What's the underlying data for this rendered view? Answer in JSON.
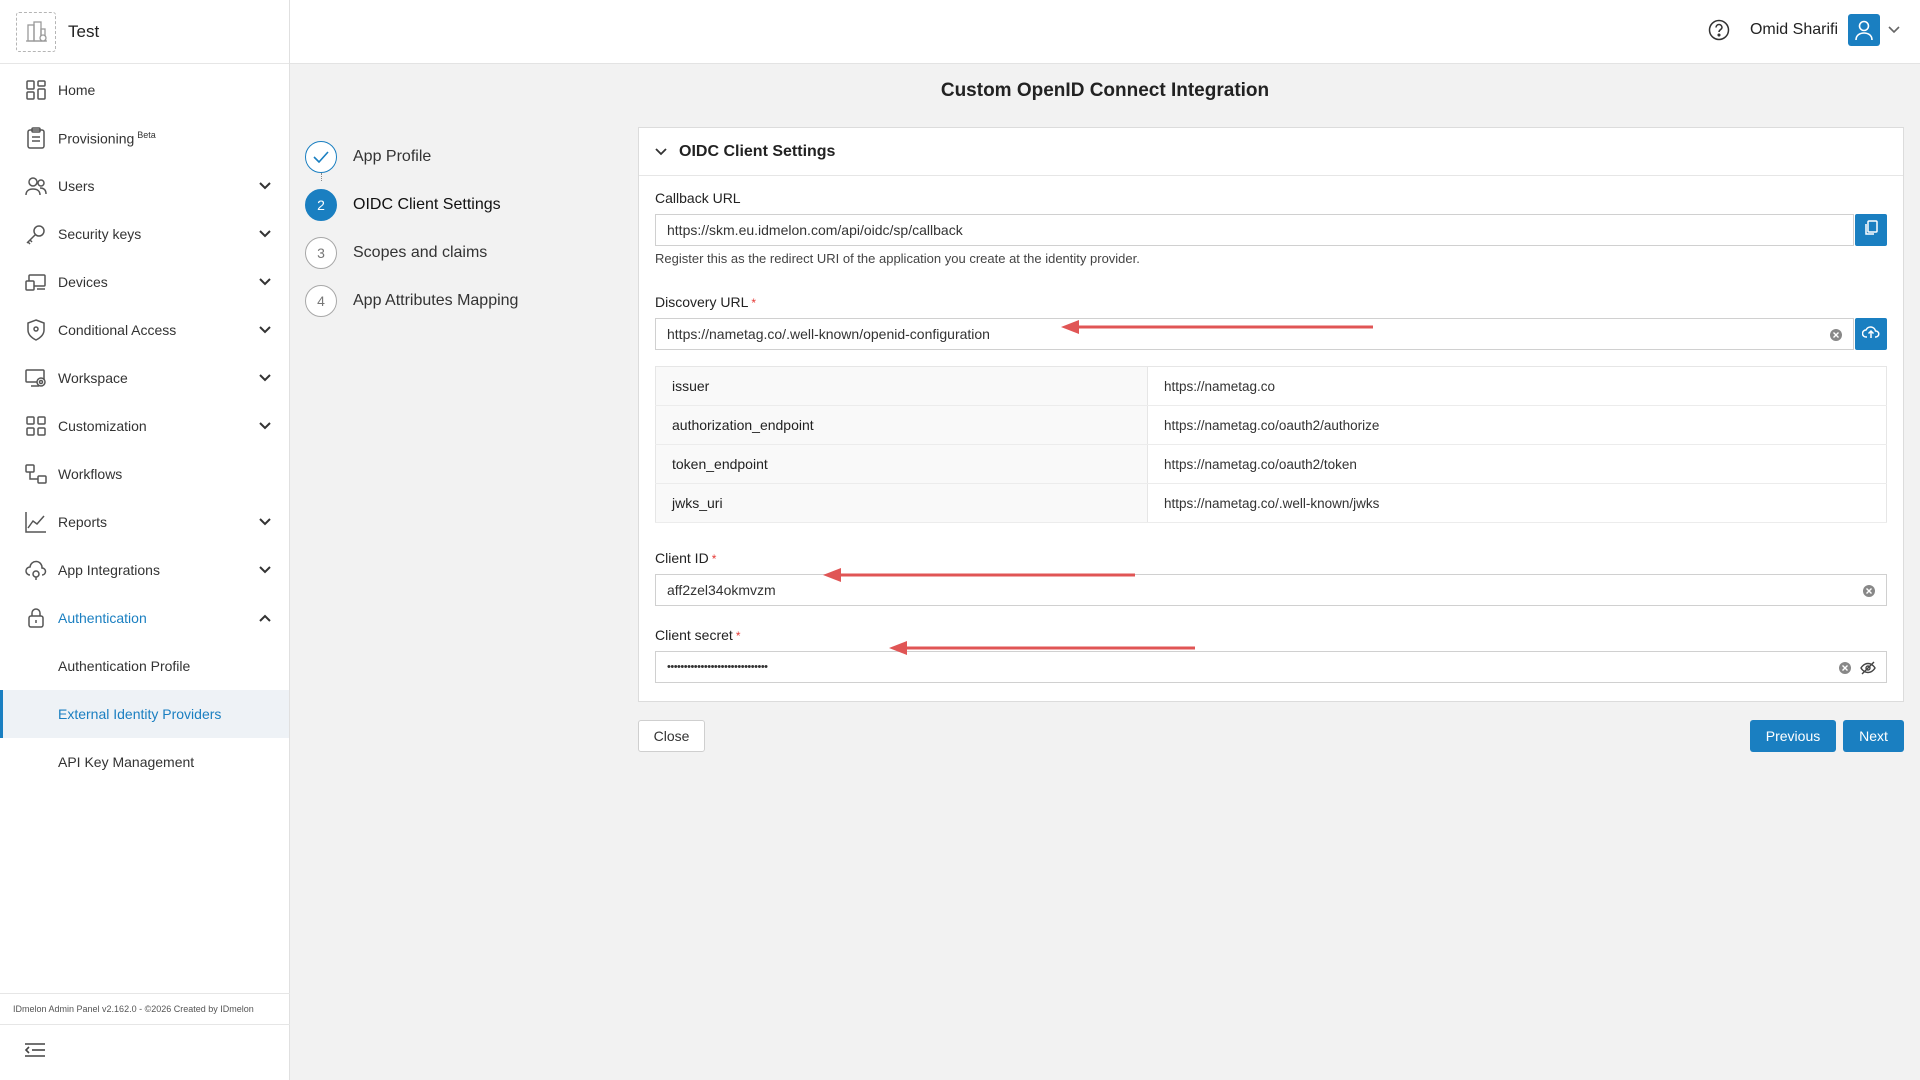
{
  "sidebar": {
    "brand": "Test",
    "items": [
      {
        "label": "Home",
        "icon": "home-icon"
      },
      {
        "label": "Provisioning",
        "badge": "Beta",
        "icon": "clipboard-icon"
      },
      {
        "label": "Users",
        "icon": "users-icon"
      },
      {
        "label": "Security keys",
        "icon": "key-icon"
      },
      {
        "label": "Devices",
        "icon": "devices-icon"
      },
      {
        "label": "Conditional Access",
        "icon": "shield-icon"
      },
      {
        "label": "Workspace",
        "icon": "workspace-icon"
      },
      {
        "label": "Customization",
        "icon": "grid-icon"
      },
      {
        "label": "Workflows",
        "icon": "workflow-icon"
      },
      {
        "label": "Reports",
        "icon": "chart-icon"
      },
      {
        "label": "App Integrations",
        "icon": "cloud-icon"
      },
      {
        "label": "Authentication",
        "icon": "lock-icon"
      }
    ],
    "sub_items": [
      {
        "label": "Authentication Profile"
      },
      {
        "label": "External Identity Providers"
      },
      {
        "label": "API Key Management"
      }
    ],
    "footer": "IDmelon Admin Panel v2.162.0 - ©2026 Created by IDmelon"
  },
  "header": {
    "user_name": "Omid Sharifi"
  },
  "page": {
    "title": "Custom OpenID Connect Integration"
  },
  "steps": [
    {
      "number": "",
      "label": "App Profile"
    },
    {
      "number": "2",
      "label": "OIDC Client Settings"
    },
    {
      "number": "3",
      "label": "Scopes and claims"
    },
    {
      "number": "4",
      "label": "App Attributes Mapping"
    }
  ],
  "panel": {
    "title": "OIDC Client Settings",
    "callback": {
      "label": "Callback URL",
      "value": "https://skm.eu.idmelon.com/api/oidc/sp/callback",
      "hint": "Register this as the redirect URI of the application you create at the identity provider."
    },
    "discovery": {
      "label": "Discovery URL",
      "required": "*",
      "value": "https://nametag.co/.well-known/openid-configuration"
    },
    "discovery_table": [
      {
        "key": "issuer",
        "value": "https://nametag.co"
      },
      {
        "key": "authorization_endpoint",
        "value": "https://nametag.co/oauth2/authorize"
      },
      {
        "key": "token_endpoint",
        "value": "https://nametag.co/oauth2/token"
      },
      {
        "key": "jwks_uri",
        "value": "https://nametag.co/.well-known/jwks"
      }
    ],
    "client_id": {
      "label": "Client ID",
      "required": "*",
      "value": "aff2zel34okmvzm"
    },
    "client_secret": {
      "label": "Client secret",
      "required": "*",
      "value": "••••••••••••••••••••••••••••••"
    }
  },
  "actions": {
    "close": "Close",
    "previous": "Previous",
    "next": "Next"
  },
  "colors": {
    "accent": "#1a7fc1",
    "annotation_arrow": "#e05555",
    "required": "#e53935"
  }
}
